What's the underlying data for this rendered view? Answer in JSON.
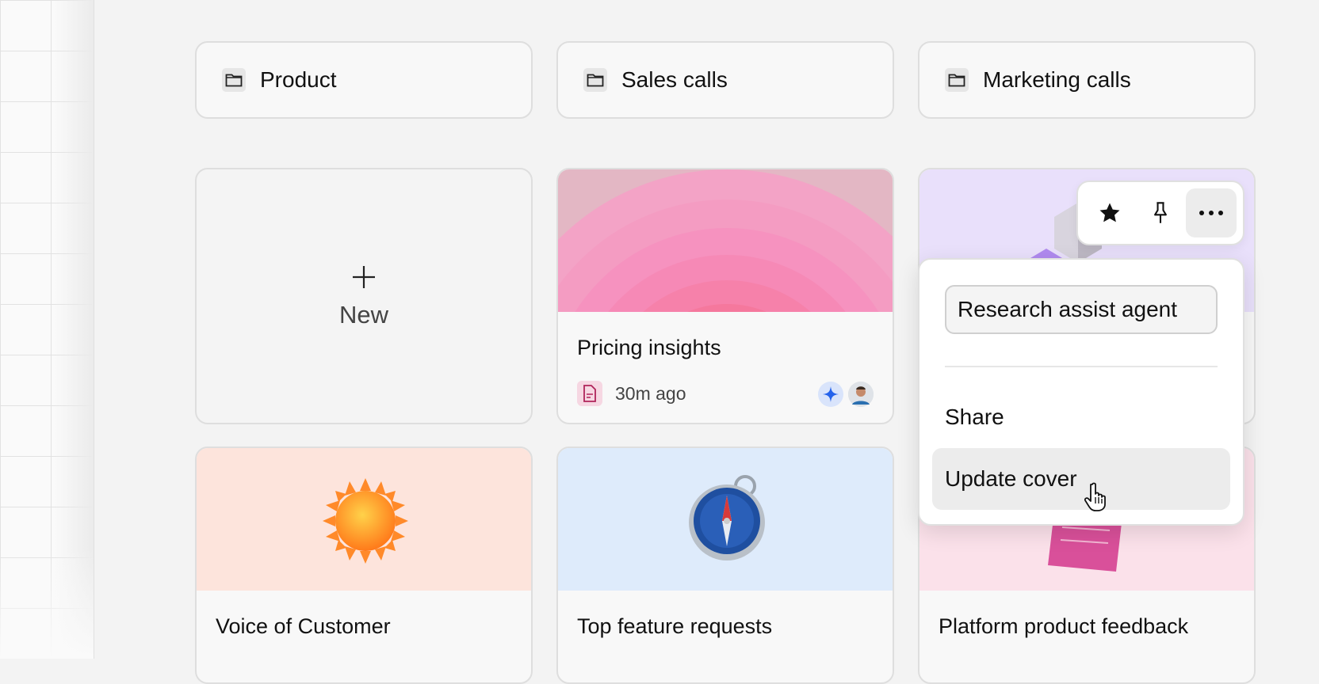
{
  "folders": [
    {
      "label": "Product",
      "icon": "folder-icon"
    },
    {
      "label": "Sales calls",
      "icon": "folder-icon"
    },
    {
      "label": "Marketing calls",
      "icon": "folder-icon"
    }
  ],
  "new_card": {
    "label": "New",
    "icon": "plus-icon"
  },
  "cards": [
    {
      "title": "Pricing insights",
      "time": "30m ago",
      "cover_color": "#f4a8c4",
      "avatars": [
        "sparkle-avatar-icon",
        "user-avatar"
      ]
    },
    {
      "title": "Research assist agent",
      "cover_color": "#e9e0fb"
    },
    {
      "title": "Voice of Customer",
      "cover_color": "#fde4dc",
      "cover_icon": "sun-icon"
    },
    {
      "title": "Top feature requests",
      "cover_color": "#deebfb",
      "cover_icon": "compass-icon"
    },
    {
      "title": "Platform product feedback",
      "cover_color": "#fbe1ea",
      "cover_icon": "sticky-note-icon"
    }
  ],
  "toolbar": {
    "items": [
      "star-icon",
      "pin-icon",
      "more-icon"
    ]
  },
  "menu": {
    "rename_value": "Research assist agent",
    "items": [
      {
        "label": "Share"
      },
      {
        "label": "Update cover"
      }
    ]
  }
}
